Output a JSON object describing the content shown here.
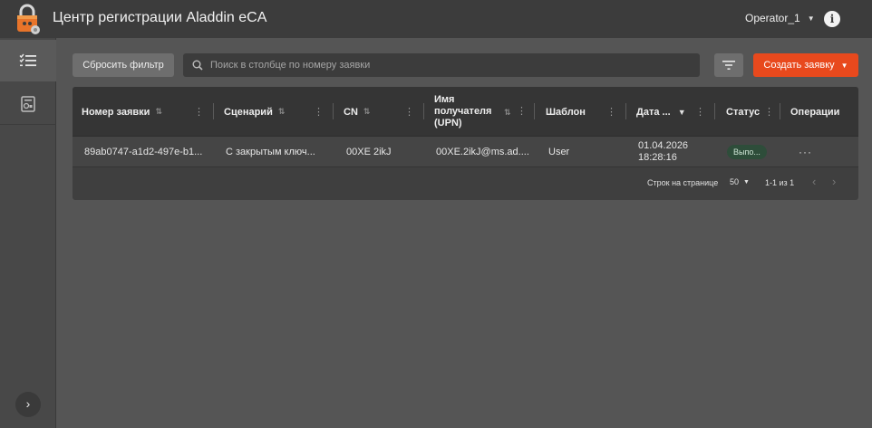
{
  "header": {
    "title": "Центр регистрации Aladdin eCA",
    "user": "Operator_1",
    "logo_icon": "padlock-logo-icon",
    "info_icon": "info-icon"
  },
  "sidebar": {
    "items": [
      {
        "icon": "checklist-icon",
        "active": true
      },
      {
        "icon": "certificate-icon",
        "active": false
      }
    ],
    "expand_icon": "chevron-right-icon"
  },
  "toolbar": {
    "reset_label": "Сбросить фильтр",
    "search_placeholder": "Поиск в столбце по номеру заявки",
    "create_label": "Создать заявку",
    "filter_icon": "filter-icon",
    "search_icon": "search-icon"
  },
  "table": {
    "columns": [
      {
        "label": "Номер заявки",
        "sortable": true
      },
      {
        "label": "Сценарий",
        "sortable": true
      },
      {
        "label": "CN",
        "sortable": true
      },
      {
        "label_lines": [
          "Имя",
          "получателя",
          "(UPN)"
        ],
        "sortable": true
      },
      {
        "label": "Шаблон",
        "sortable": false
      },
      {
        "label": "Дата ...",
        "sortable": true,
        "sort_direction": "desc"
      },
      {
        "label": "Статус",
        "sortable": false
      },
      {
        "label": "Операции",
        "sortable": false
      }
    ],
    "rows": [
      {
        "id": "89ab0747-a1d2-497e-b1...",
        "scenario": "С закрытым ключ...",
        "cn": "00XE 2ikJ",
        "upn": "00XE.2ikJ@ms.ad....",
        "template": "User",
        "date_line1": "01.04.2026",
        "date_line2": "18:28:16",
        "status": "Выпо...",
        "operations": "···"
      }
    ],
    "footer": {
      "rows_per_page_label": "Строк на странице",
      "rows_per_page_value": "50",
      "range": "1-1 из 1"
    }
  },
  "colors": {
    "accent": "#e8491d",
    "status_badge_bg": "#2e4d3a"
  }
}
